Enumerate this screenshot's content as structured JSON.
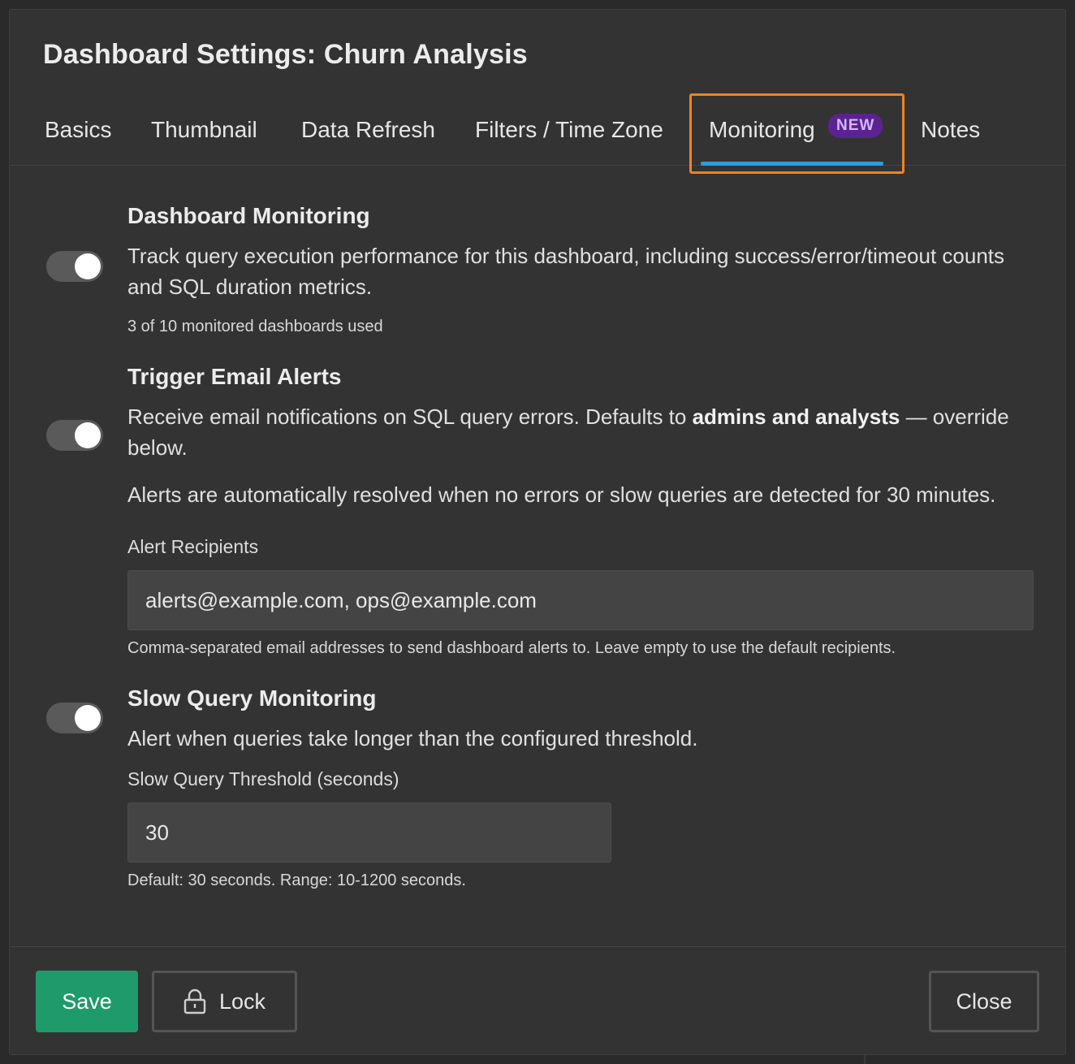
{
  "modal": {
    "title": "Dashboard Settings: Churn Analysis"
  },
  "tabs": [
    {
      "label": "Basics",
      "active": false
    },
    {
      "label": "Thumbnail",
      "active": false
    },
    {
      "label": "Data Refresh",
      "active": false
    },
    {
      "label": "Filters / Time Zone",
      "active": false
    },
    {
      "label": "Monitoring",
      "active": true,
      "badge": "NEW"
    },
    {
      "label": "Notes",
      "active": false
    }
  ],
  "dashboard_monitoring": {
    "title": "Dashboard Monitoring",
    "description": "Track query execution performance for this dashboard, including success/error/timeout counts and SQL duration metrics.",
    "usage": "3 of 10 monitored dashboards used",
    "enabled": true
  },
  "email_alerts": {
    "title": "Trigger Email Alerts",
    "description_prefix": "Receive email notifications on SQL query errors. Defaults to ",
    "description_bold": "admins and analysts",
    "description_suffix": " — override below.",
    "auto_resolve_note": "Alerts are automatically resolved when no errors or slow queries are detected for 30 minutes.",
    "enabled": true,
    "recipients_label": "Alert Recipients",
    "recipients_value": "alerts@example.com, ops@example.com",
    "recipients_help": "Comma-separated email addresses to send dashboard alerts to. Leave empty to use the default recipients."
  },
  "slow_query": {
    "title": "Slow Query Monitoring",
    "description": "Alert when queries take longer than the configured threshold.",
    "enabled": true,
    "threshold_label": "Slow Query Threshold (seconds)",
    "threshold_value": "30",
    "threshold_help": "Default: 30 seconds. Range: 10-1200 seconds."
  },
  "footer": {
    "save_label": "Save",
    "lock_label": "Lock",
    "close_label": "Close"
  },
  "colors": {
    "accent_tab_underline": "#2d9cdb",
    "highlight_box": "#f08322",
    "save_button": "#1f9a6b",
    "badge_bg": "#5a2391"
  }
}
